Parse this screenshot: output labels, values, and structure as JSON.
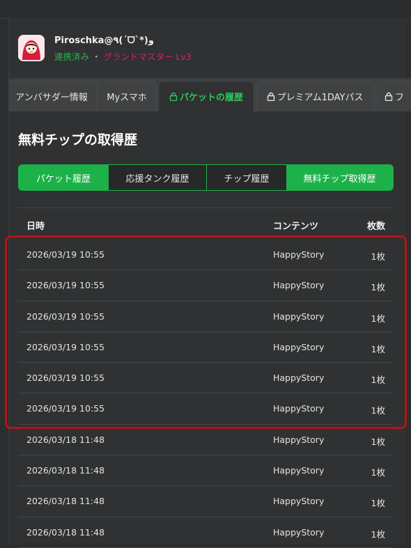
{
  "user": {
    "name": "Piroschka@٩(ˊᗜˋ*)و",
    "status": "連携済み",
    "separator": "・",
    "rank": "グランドマスター",
    "level": "Lv3"
  },
  "tabs": [
    {
      "label": "アンバサダー情報",
      "locked": false,
      "active": false
    },
    {
      "label": "Myスマホ",
      "locked": false,
      "active": false
    },
    {
      "label": "パケットの履歴",
      "locked": true,
      "active": true
    },
    {
      "label": "プレミアム1DAYパス",
      "locked": true,
      "active": false
    },
    {
      "label": "フ",
      "locked": true,
      "active": false
    }
  ],
  "page_title": "無料チップの取得歴",
  "segments": [
    {
      "label": "パケット履歴",
      "active": true
    },
    {
      "label": "応援タンク履歴",
      "active": false
    },
    {
      "label": "チップ履歴",
      "active": false
    },
    {
      "label": "無料チップ取得歴",
      "active": true
    }
  ],
  "table": {
    "headers": {
      "datetime": "日時",
      "content": "コンテンツ",
      "count": "枚数"
    },
    "rows": [
      {
        "datetime": "2026/03/19 10:55",
        "content": "HappyStory",
        "count": "1枚"
      },
      {
        "datetime": "2026/03/19 10:55",
        "content": "HappyStory",
        "count": "1枚"
      },
      {
        "datetime": "2026/03/19 10:55",
        "content": "HappyStory",
        "count": "1枚"
      },
      {
        "datetime": "2026/03/19 10:55",
        "content": "HappyStory",
        "count": "1枚"
      },
      {
        "datetime": "2026/03/19 10:55",
        "content": "HappyStory",
        "count": "1枚"
      },
      {
        "datetime": "2026/03/19 10:55",
        "content": "HappyStory",
        "count": "1枚"
      },
      {
        "datetime": "2026/03/18 11:48",
        "content": "HappyStory",
        "count": "1枚"
      },
      {
        "datetime": "2026/03/18 11:48",
        "content": "HappyStory",
        "count": "1枚"
      },
      {
        "datetime": "2026/03/18 11:48",
        "content": "HappyStory",
        "count": "1枚"
      },
      {
        "datetime": "2026/03/18 11:48",
        "content": "HappyStory",
        "count": "1枚"
      }
    ]
  },
  "colors": {
    "accent_green": "#1db249",
    "rank_pink": "#d9206c",
    "highlight_red": "#b41414"
  }
}
